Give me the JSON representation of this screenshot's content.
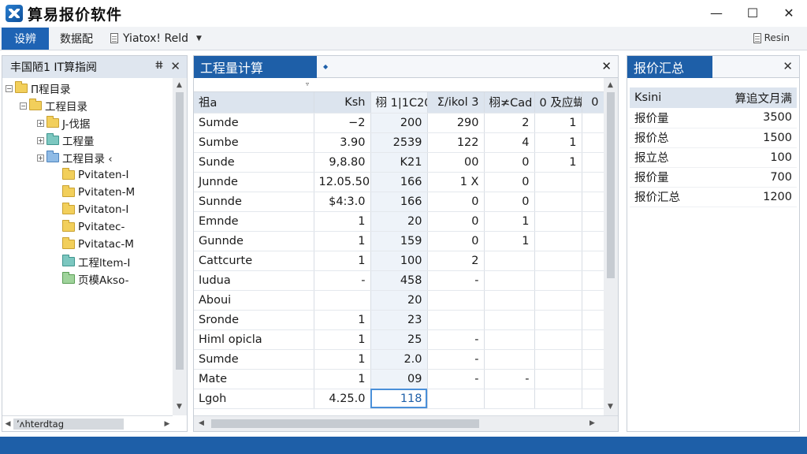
{
  "app": {
    "title": "算易报价软件"
  },
  "window_controls": {
    "minimize": "—",
    "maximize": "☐",
    "close": "✕"
  },
  "menubar": {
    "active": "设辨",
    "item2": "数据配",
    "doc_label": "Yiatox! Reld",
    "right_label": "Resin"
  },
  "tree_panel": {
    "title": "丰国陋1 IT算指阋",
    "pin": "ⵌ",
    "close": "✕",
    "scroll_label": "ʼʌhterdtag",
    "items": [
      {
        "label": "Π程目录",
        "toggle": "−",
        "folder": "yellow"
      },
      {
        "label": "工程目录",
        "toggle": "−",
        "folder": "yellow"
      },
      {
        "label": "J-伐据",
        "toggle": "+",
        "folder": "yellow"
      },
      {
        "label": "工程量",
        "toggle": "+",
        "folder": "teal"
      },
      {
        "label": "工程目录 ‹",
        "toggle": "+",
        "folder": "blue"
      },
      {
        "label": "Pvitaten-I",
        "folder": "yellow"
      },
      {
        "label": "Pvitaten-M",
        "folder": "yellow"
      },
      {
        "label": "Pvitaton-I",
        "folder": "yellow"
      },
      {
        "label": "Pvitatec-",
        "folder": "yellow"
      },
      {
        "label": "Pvitatac-M",
        "folder": "yellow"
      },
      {
        "label": "工程ltem-I",
        "folder": "teal"
      },
      {
        "label": "页模Akso-",
        "folder": "green"
      }
    ]
  },
  "grid_panel": {
    "tab_title": "工程量计算",
    "tab_icon": "◆",
    "close": "✕",
    "sub_caret": "▿",
    "headers": [
      "祖a",
      "Ksh",
      "栩 1|1C20",
      "Σ/ikol 3",
      "栩≭Cad",
      "0 及应蝴",
      "0"
    ],
    "rows": [
      [
        "Sumde",
        "−2",
        "200",
        "290",
        "2",
        "1",
        ""
      ],
      [
        "Sumbe",
        "3.90",
        "2539",
        "122",
        "4",
        "1",
        ""
      ],
      [
        "Sunde",
        "9,8.80",
        "K21",
        "00",
        "0",
        "1",
        ""
      ],
      [
        "Junnde",
        "12.05.50",
        "166",
        "1 X",
        "0",
        "",
        ""
      ],
      [
        "Sunnde",
        "$4:3.0",
        "166",
        "0",
        "0",
        "",
        ""
      ],
      [
        "Emnde",
        "1",
        "20",
        "0",
        "1",
        "",
        ""
      ],
      [
        "Gunnde",
        "1",
        "159",
        "0",
        "1",
        "",
        ""
      ],
      [
        "Cattcurte",
        "1",
        "100",
        "2",
        "",
        "",
        ""
      ],
      [
        "Iudua",
        "-",
        "458",
        "-",
        "",
        "",
        ""
      ],
      [
        "Aboui",
        "",
        "20",
        "",
        "",
        "",
        ""
      ],
      [
        "Sronde",
        "1",
        "23",
        "",
        "",
        "",
        ""
      ],
      [
        "Himl opicla",
        "1",
        "25",
        "-",
        "",
        "",
        ""
      ],
      [
        "Sumde",
        "1",
        "2.0",
        "-",
        "",
        "",
        ""
      ],
      [
        "Mate",
        "1",
        "09",
        "-",
        "-",
        "",
        ""
      ],
      [
        "Lgoh",
        "4.25.0",
        "118",
        "",
        "",
        "",
        ""
      ]
    ]
  },
  "summary_panel": {
    "tab_title": "报价汇总",
    "close": "✕",
    "header_left": "Ksini",
    "header_right": "算追文月满",
    "rows": [
      {
        "label": "报价量",
        "value": "3500"
      },
      {
        "label": "报价总",
        "value": "1500"
      },
      {
        "label": "报立总",
        "value": "100"
      },
      {
        "label": "报价量",
        "value": "700"
      },
      {
        "label": "报价汇总",
        "value": "1200"
      }
    ]
  }
}
